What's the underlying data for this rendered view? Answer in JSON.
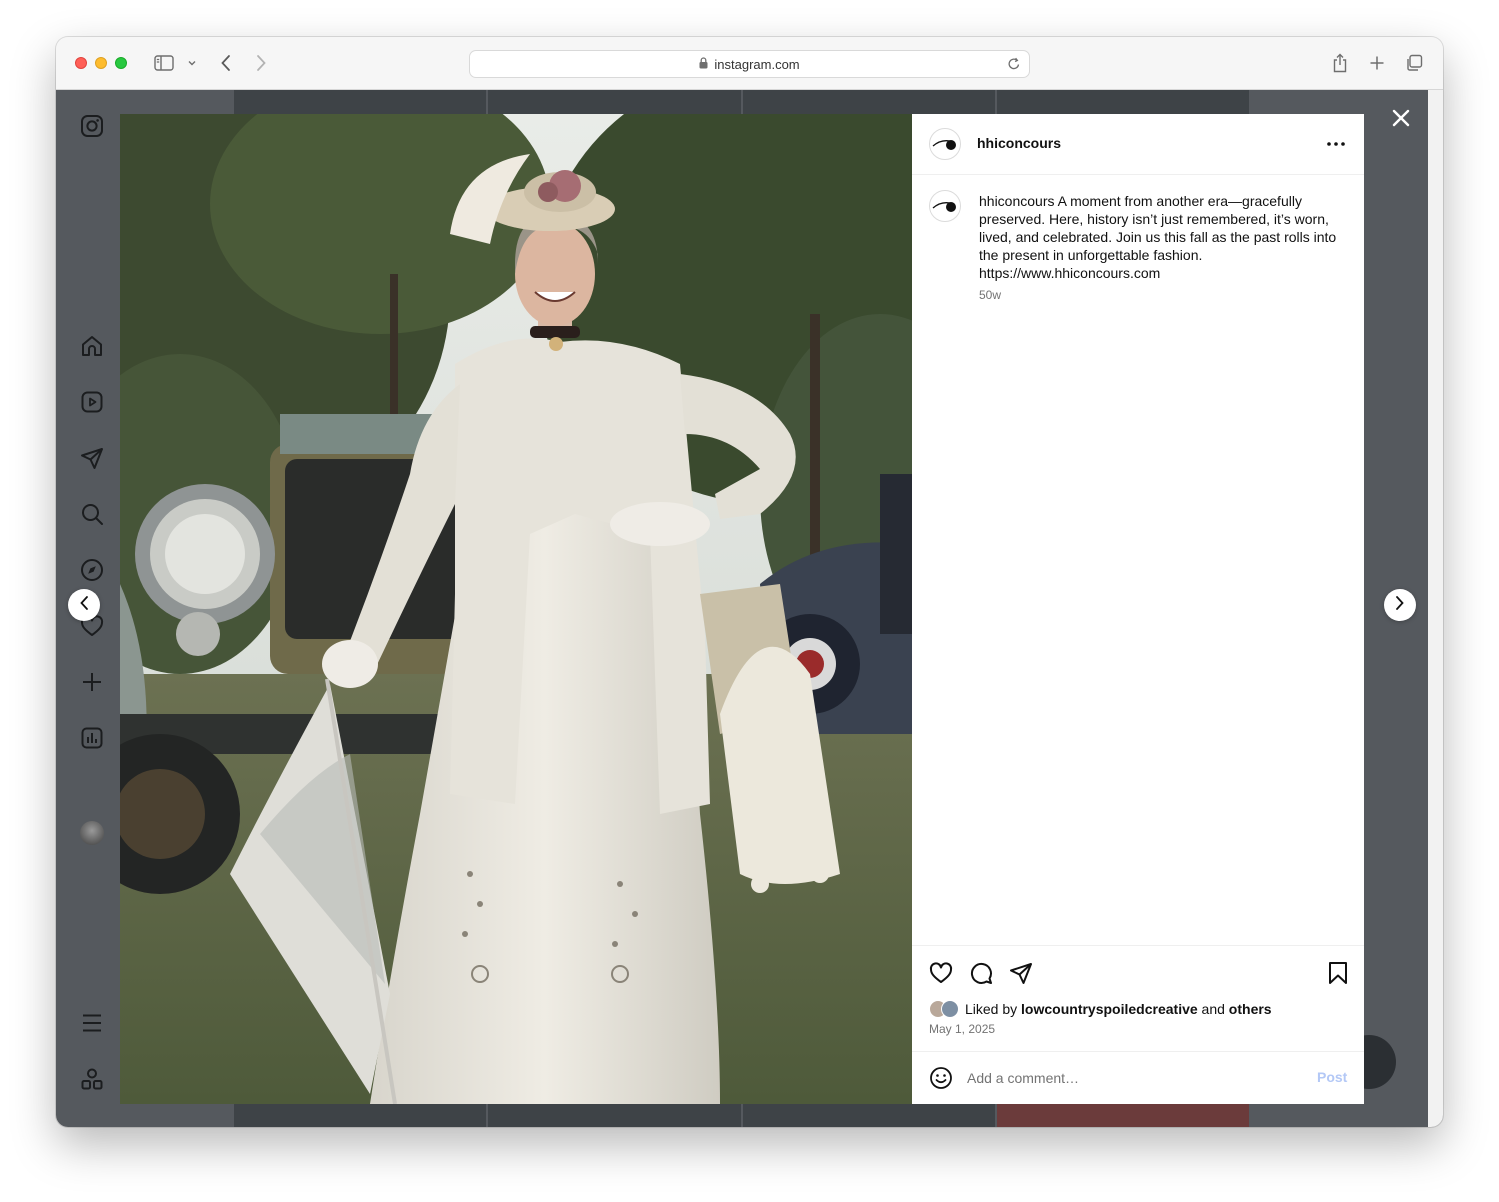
{
  "browser": {
    "url": "instagram.com"
  },
  "post": {
    "username": "hhiconcours",
    "caption_user": "hhiconcours",
    "caption_body": "A moment from another era—gracefully preserved. Here, history isn’t just remembered, it’s worn, lived, and celebrated. Join us this fall as the past rolls into the present in unforgettable fashion. https://www.hhiconcours.com",
    "caption_age": "50w",
    "liked_prefix": "Liked by",
    "liked_user": "lowcountryspoiledcreative",
    "liked_and": "and",
    "liked_others": "others",
    "date": "May 1, 2025",
    "comment_placeholder": "Add a comment…",
    "post_label": "Post"
  },
  "icons": {
    "sidebar": [
      "instagram-logo-icon",
      "home-icon",
      "reels-icon",
      "messages-icon",
      "search-icon",
      "explore-icon",
      "notifications-icon",
      "create-icon",
      "dashboard-icon",
      "profile-avatar",
      "menu-icon",
      "apps-icon"
    ],
    "actions": [
      "heart-icon",
      "comment-icon",
      "share-icon",
      "bookmark-icon"
    ]
  },
  "colors": {
    "overlay": "#55595e",
    "post_button_disabled": "#b3c8f6",
    "muted_text": "#737373"
  }
}
